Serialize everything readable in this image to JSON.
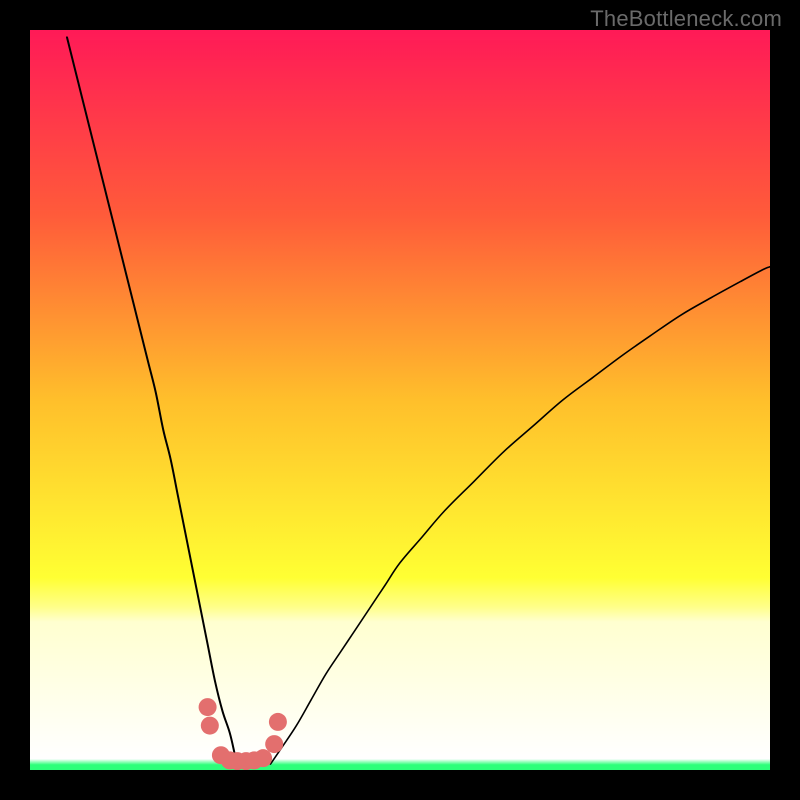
{
  "watermark": "TheBottleneck.com",
  "chart_data": {
    "type": "line",
    "title": "",
    "xlabel": "",
    "ylabel": "",
    "xlim": [
      0,
      100
    ],
    "ylim": [
      0,
      100
    ],
    "grid": false,
    "legend": false,
    "background_gradient": {
      "stops": [
        {
          "offset": 0.0,
          "color": "#ff1a57"
        },
        {
          "offset": 0.25,
          "color": "#ff5b3a"
        },
        {
          "offset": 0.5,
          "color": "#ffbf2b"
        },
        {
          "offset": 0.74,
          "color": "#ffff33"
        },
        {
          "offset": 0.78,
          "color": "#ffff8a"
        },
        {
          "offset": 0.8,
          "color": "#ffffd0"
        },
        {
          "offset": 0.985,
          "color": "#ffffff"
        },
        {
          "offset": 0.993,
          "color": "#2cff7a"
        }
      ]
    },
    "series": [
      {
        "name": "curve-left",
        "color": "#000000",
        "width": 2,
        "x": [
          5,
          6,
          7,
          8,
          9,
          10,
          11,
          12,
          13,
          14,
          15,
          16,
          17,
          18,
          19,
          20,
          21,
          22,
          23,
          24,
          25,
          26,
          27,
          27.7,
          28.0
        ],
        "y": [
          99,
          95,
          91,
          87,
          83,
          79,
          75,
          71,
          67,
          63,
          59,
          55,
          51,
          46,
          42,
          37,
          32,
          27,
          22,
          17,
          12,
          8,
          5,
          2,
          0.8
        ]
      },
      {
        "name": "curve-right",
        "color": "#000000",
        "width": 1.6,
        "x": [
          32.5,
          34,
          36,
          38,
          40,
          42,
          44,
          46,
          48,
          50,
          53,
          56,
          60,
          64,
          68,
          72,
          76,
          80,
          84,
          88,
          92,
          96,
          99,
          100
        ],
        "y": [
          0.8,
          3,
          6,
          9.5,
          13,
          16,
          19,
          22,
          25,
          28,
          31.5,
          35,
          39,
          43,
          46.5,
          50,
          53,
          56,
          58.8,
          61.5,
          63.8,
          66,
          67.6,
          68
        ]
      },
      {
        "name": "valley-scatter",
        "type": "scatter",
        "color": "#e36f6e",
        "radius": 9,
        "x": [
          24.0,
          24.3,
          25.8,
          27.0,
          28.0,
          29.2,
          30.3,
          31.5,
          33.0,
          33.5
        ],
        "y": [
          8.5,
          6.0,
          2.0,
          1.3,
          1.2,
          1.2,
          1.3,
          1.6,
          3.5,
          6.5
        ]
      }
    ]
  }
}
